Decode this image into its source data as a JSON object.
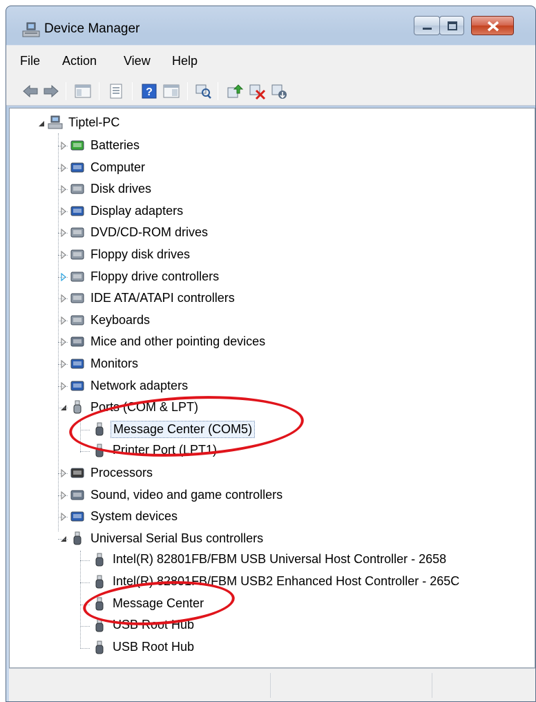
{
  "window": {
    "title": "Device Manager"
  },
  "menu": [
    "File",
    "Action",
    "View",
    "Help"
  ],
  "toolbar_icons": [
    "back-icon",
    "forward-icon",
    "show-hide-console-tree-icon",
    "properties-icon",
    "help-icon",
    "action-pane-icon",
    "scan-hardware-icon",
    "update-driver-icon",
    "uninstall-device-icon",
    "disable-device-icon"
  ],
  "tree": {
    "root": "Tiptel-PC",
    "categories": [
      {
        "label": "Batteries"
      },
      {
        "label": "Computer"
      },
      {
        "label": "Disk drives"
      },
      {
        "label": "Display adapters"
      },
      {
        "label": "DVD/CD-ROM drives"
      },
      {
        "label": "Floppy disk drives"
      },
      {
        "label": "Floppy drive controllers"
      },
      {
        "label": "IDE ATA/ATAPI controllers"
      },
      {
        "label": "Keyboards"
      },
      {
        "label": "Mice and other pointing devices"
      },
      {
        "label": "Monitors"
      },
      {
        "label": "Network adapters"
      },
      {
        "label": "Ports (COM & LPT)",
        "children": [
          "Message Center (COM5)",
          "Printer Port (LPT1)"
        ]
      },
      {
        "label": "Processors"
      },
      {
        "label": "Sound, video and game controllers"
      },
      {
        "label": "System devices"
      },
      {
        "label": "Universal Serial Bus controllers",
        "children": [
          "Intel(R) 82801FB/FBM USB Universal Host Controller - 2658",
          "Intel(R) 82801FB/FBM USB2 Enhanced Host Controller - 265C",
          "Message Center",
          "USB Root Hub",
          "USB Root Hub"
        ]
      }
    ],
    "selected": "Message Center (COM5)"
  },
  "colors": {
    "annotation": "#e0141b",
    "titlebar": "#b7cbe3"
  }
}
